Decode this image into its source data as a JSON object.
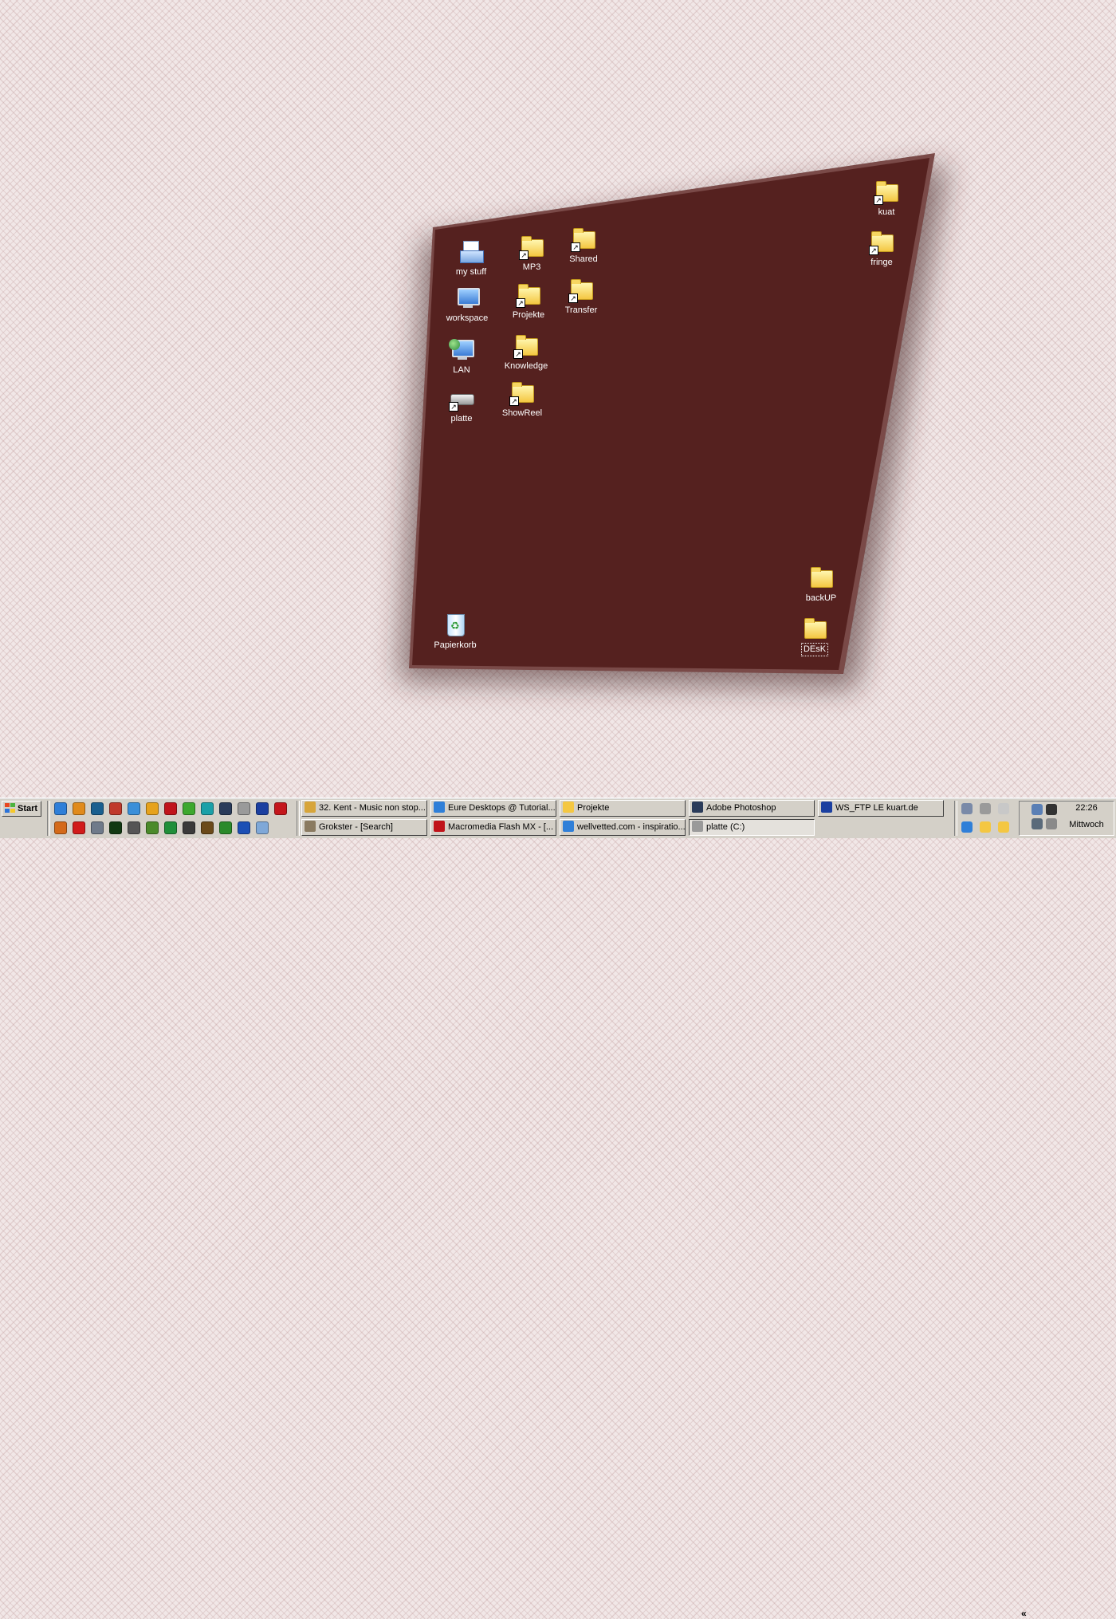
{
  "desktop": {
    "panel_color": "#55211f",
    "icons": [
      {
        "name": "my-stuff",
        "label": "my stuff",
        "kind": "docfolder",
        "shortcut": false
      },
      {
        "name": "workspace",
        "label": "workspace",
        "kind": "computer",
        "shortcut": false
      },
      {
        "name": "lan",
        "label": "LAN",
        "kind": "network",
        "shortcut": false
      },
      {
        "name": "platte",
        "label": "platte",
        "kind": "drive",
        "shortcut": true
      },
      {
        "name": "mp3",
        "label": "MP3",
        "kind": "folder",
        "shortcut": true
      },
      {
        "name": "projekte",
        "label": "Projekte",
        "kind": "folder",
        "shortcut": true
      },
      {
        "name": "knowledge",
        "label": "Knowledge",
        "kind": "folder",
        "shortcut": true
      },
      {
        "name": "showreel",
        "label": "ShowReel",
        "kind": "folder",
        "shortcut": true
      },
      {
        "name": "shared",
        "label": "Shared",
        "kind": "folder",
        "shortcut": true
      },
      {
        "name": "transfer",
        "label": "Transfer",
        "kind": "folder",
        "shortcut": true
      },
      {
        "name": "kuat",
        "label": "kuat",
        "kind": "folder",
        "shortcut": true
      },
      {
        "name": "fringe",
        "label": "fringe",
        "kind": "folder",
        "shortcut": true
      },
      {
        "name": "backup",
        "label": "backUP",
        "kind": "folder",
        "shortcut": false
      },
      {
        "name": "desk",
        "label": "DEsK",
        "kind": "folder",
        "shortcut": false,
        "selected": true
      },
      {
        "name": "papierkorb",
        "label": "Papierkorb",
        "kind": "recycle",
        "shortcut": false
      }
    ]
  },
  "taskbar": {
    "start_label": "Start",
    "quick_launch": [
      {
        "icon": "internet-explorer-icon",
        "color": "#2f7fd8"
      },
      {
        "icon": "outlook-icon",
        "color": "#e08a1c"
      },
      {
        "icon": "netscape-icon",
        "color": "#1a5f8f"
      },
      {
        "icon": "toolbox-icon",
        "color": "#c0392b"
      },
      {
        "icon": "messenger-icon",
        "color": "#3a8fd9"
      },
      {
        "icon": "pen-icon",
        "color": "#e6a21c"
      },
      {
        "icon": "flash-icon",
        "color": "#c0141b"
      },
      {
        "icon": "dreamweaver-icon",
        "color": "#3da82e"
      },
      {
        "icon": "fireworks-icon",
        "color": "#1aa0a8"
      },
      {
        "icon": "photoshop-icon",
        "color": "#2a3b5a"
      },
      {
        "icon": "pattern-icon",
        "color": "#9a9a9a"
      },
      {
        "icon": "ftp-icon",
        "color": "#1b3fa0"
      },
      {
        "icon": "acrobat-icon",
        "color": "#c4161c"
      },
      {
        "icon": "winamp-icon",
        "color": "#d46a1a"
      },
      {
        "icon": "shield-icon",
        "color": "#d11b1b"
      },
      {
        "icon": "gear-icon",
        "color": "#6f7a8a"
      },
      {
        "icon": "mx-icon",
        "color": "#123912"
      },
      {
        "icon": "mail-icon",
        "color": "#555555"
      },
      {
        "icon": "freehand-icon",
        "color": "#4a8a2a"
      },
      {
        "icon": "clover-icon",
        "color": "#1f8f3a"
      },
      {
        "icon": "terminal-icon",
        "color": "#3a3a3a"
      },
      {
        "icon": "film-icon",
        "color": "#6b4a1a"
      },
      {
        "icon": "chat-icon",
        "color": "#2a8a2a"
      },
      {
        "icon": "eye-icon",
        "color": "#1b4fb5"
      },
      {
        "icon": "notepad-icon",
        "color": "#7fa8d8"
      }
    ],
    "tasks": [
      {
        "name": "task-winamp",
        "label": "32. Kent - Music non stop...",
        "color": "#d7a53a",
        "pressed": false
      },
      {
        "name": "task-eure-desktops",
        "label": "Eure Desktops @ Tutorial...",
        "color": "#2f7fd8",
        "pressed": false
      },
      {
        "name": "task-projekte",
        "label": "Projekte",
        "color": "#f4c742",
        "pressed": false
      },
      {
        "name": "task-photoshop",
        "label": "Adobe Photoshop",
        "color": "#2a3b5a",
        "pressed": false
      },
      {
        "name": "task-wsftp",
        "label": "WS_FTP LE kuart.de",
        "color": "#1b3fa0",
        "pressed": false
      },
      {
        "name": "task-grokster",
        "label": "Grokster - [Search]",
        "color": "#8a7a60",
        "pressed": false
      },
      {
        "name": "task-flash",
        "label": "Macromedia Flash MX - [...",
        "color": "#c0141b",
        "pressed": false
      },
      {
        "name": "task-wellvetted",
        "label": "wellvetted.com - inspiratio...",
        "color": "#2f7fd8",
        "pressed": false
      },
      {
        "name": "task-platte",
        "label": "platte (C:)",
        "color": "#9a9a9a",
        "pressed": true
      }
    ],
    "tray": {
      "expand_label": "«",
      "icons": [
        {
          "icon": "network-tray-icon",
          "color": "#5a7fb5"
        },
        {
          "icon": "g-tray-icon",
          "color": "#333333"
        },
        {
          "icon": "update-tray-icon",
          "color": "#5a6a7a"
        },
        {
          "icon": "sync-tray-icon",
          "color": "#8a8a8a"
        }
      ],
      "extra_icons": [
        {
          "icon": "usb-icon",
          "color": "#7a8aa8"
        },
        {
          "icon": "disk-icon",
          "color": "#9a9a9a"
        },
        {
          "icon": "cd-icon",
          "color": "#c8c8c8"
        },
        {
          "icon": "app-icon",
          "color": "#2f7fd8"
        },
        {
          "icon": "folder-icon",
          "color": "#f4c742"
        },
        {
          "icon": "folder-icon-2",
          "color": "#f4c742"
        }
      ],
      "time": "22:26",
      "day": "Mittwoch"
    }
  }
}
